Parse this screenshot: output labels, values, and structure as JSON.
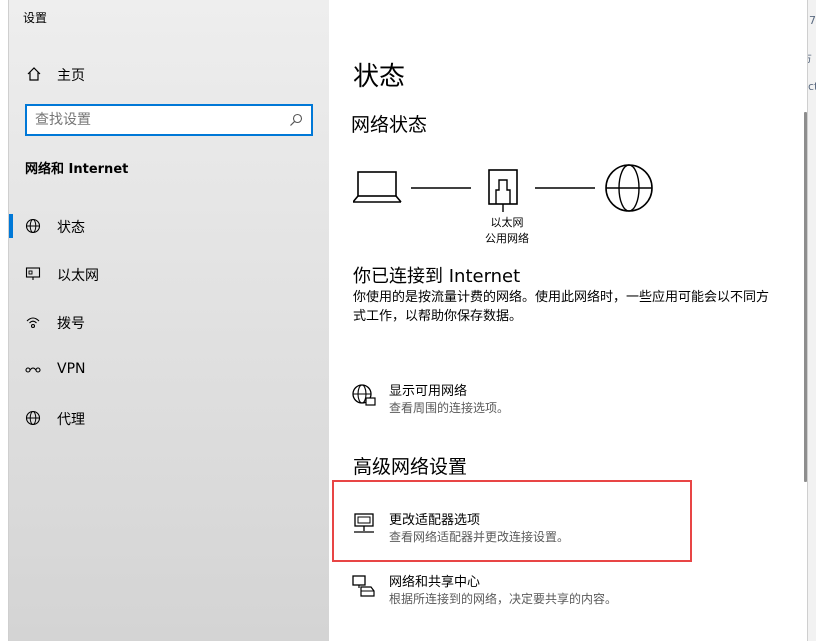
{
  "window": {
    "title": "设置",
    "controls": {
      "minimize": "minimize",
      "maximize": "maximize",
      "close": "close"
    }
  },
  "sidebar": {
    "home_label": "主页",
    "search_placeholder": "查找设置",
    "section_title": "网络和 Internet",
    "items": [
      {
        "label": "状态",
        "icon": "globe-icon",
        "active": true
      },
      {
        "label": "以太网",
        "icon": "ethernet-icon",
        "active": false
      },
      {
        "label": "拨号",
        "icon": "dialup-icon",
        "active": false
      },
      {
        "label": "VPN",
        "icon": "vpn-icon",
        "active": false
      },
      {
        "label": "代理",
        "icon": "globe-icon",
        "active": false
      }
    ]
  },
  "main": {
    "page_title": "状态",
    "network_status_heading": "网络状态",
    "diagram": {
      "adapter_name": "以太网",
      "network_type": "公用网络"
    },
    "connected_heading": "你已连接到 Internet",
    "connected_desc": "你使用的是按流量计费的网络。使用此网络时，一些应用可能会以不同方式工作，以帮助你保存数据。",
    "show_networks": {
      "title": "显示可用网络",
      "subtitle": "查看周围的连接选项。"
    },
    "advanced_heading": "高级网络设置",
    "change_adapter": {
      "title": "更改适配器选项",
      "subtitle": "查看网络适配器并更改连接设置。"
    },
    "sharing_center": {
      "title": "网络和共享中心",
      "subtitle": "根据所连接到的网络，决定要共享的内容。"
    }
  },
  "background": {
    "right_glyphs": [
      "7",
      "方",
      "ct"
    ]
  },
  "colors": {
    "accent": "#0078d7",
    "highlight": "#e84545"
  }
}
